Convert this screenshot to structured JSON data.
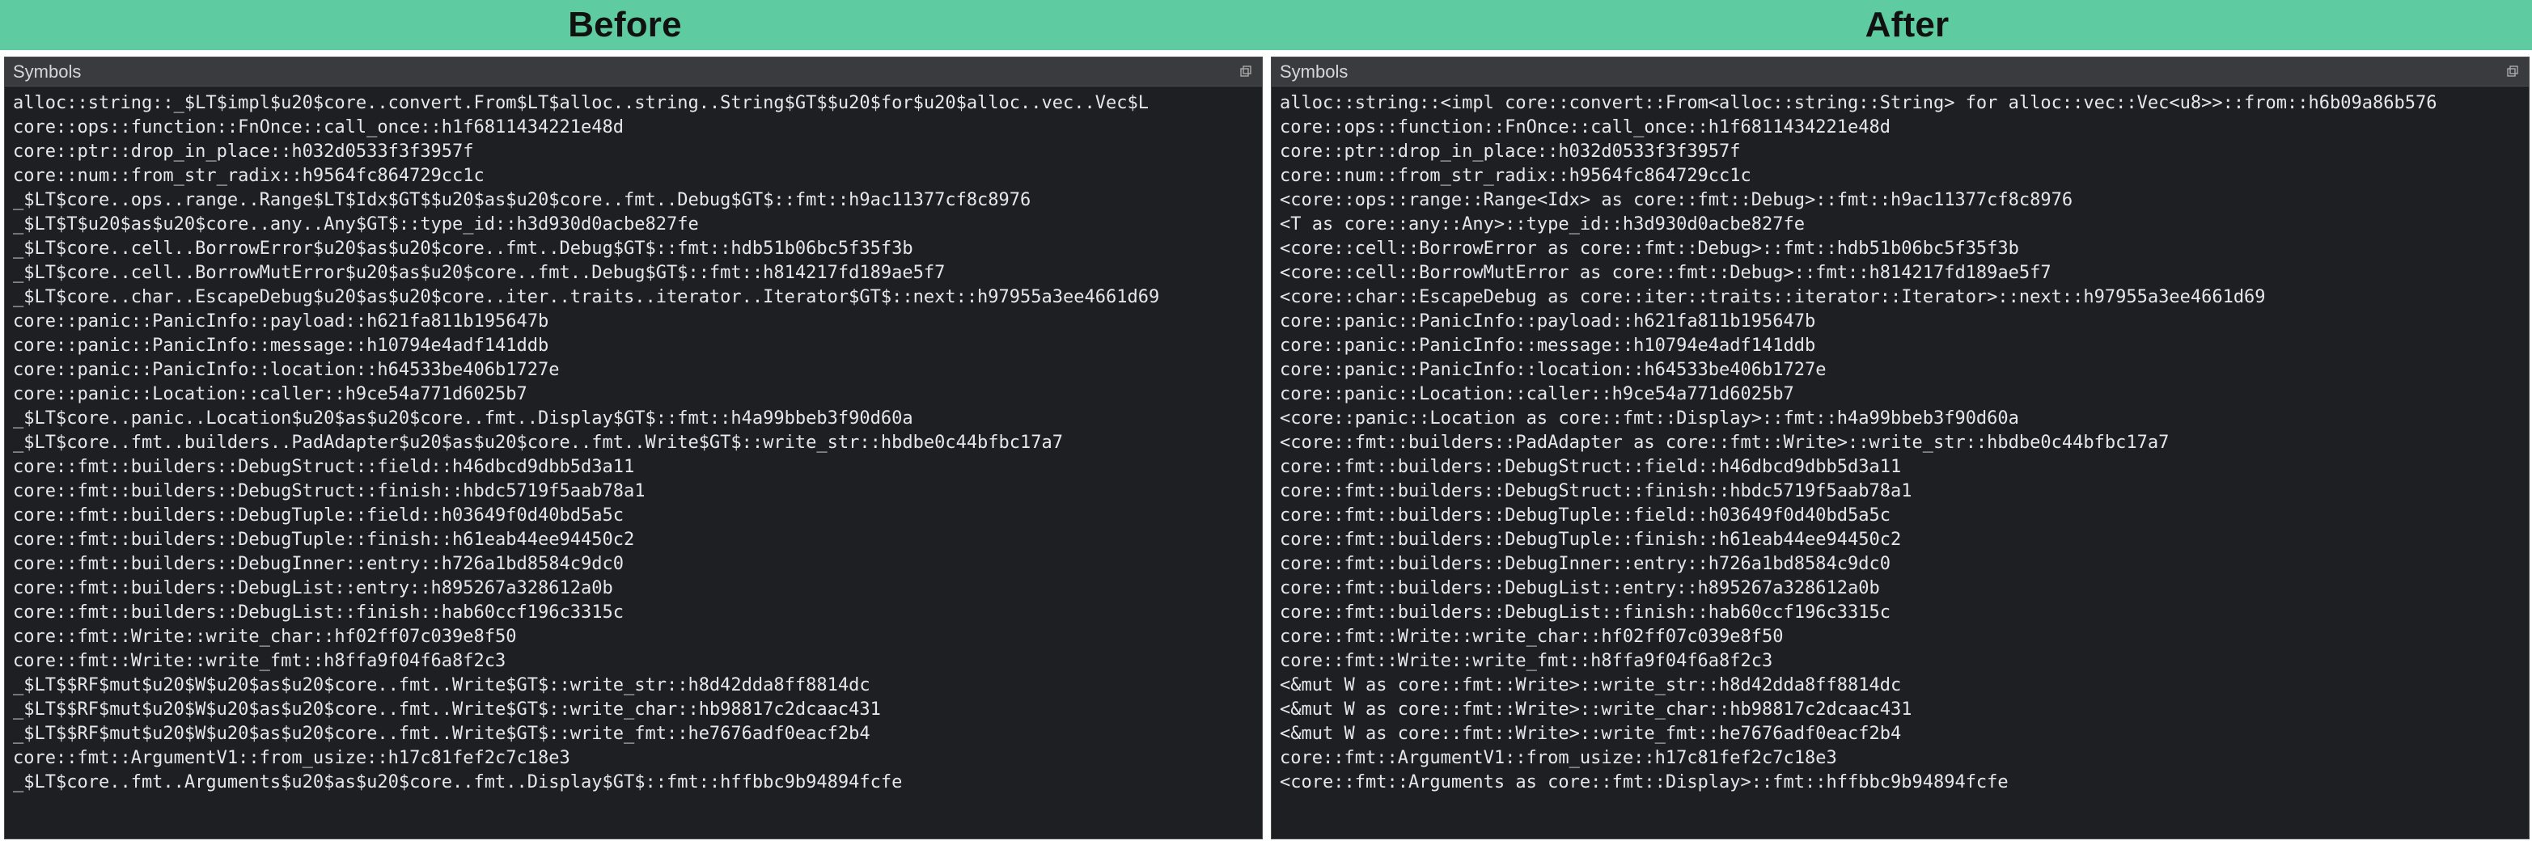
{
  "titles": {
    "before": "Before",
    "after": "After"
  },
  "pane_header": "Symbols",
  "before_lines": [
    "alloc::string::_$LT$impl$u20$core..convert.From$LT$alloc..string..String$GT$$u20$for$u20$alloc..vec..Vec$L",
    "core::ops::function::FnOnce::call_once::h1f6811434221e48d",
    "core::ptr::drop_in_place::h032d0533f3f3957f",
    "core::num::from_str_radix::h9564fc864729cc1c",
    "_$LT$core..ops..range..Range$LT$Idx$GT$$u20$as$u20$core..fmt..Debug$GT$::fmt::h9ac11377cf8c8976",
    "_$LT$T$u20$as$u20$core..any..Any$GT$::type_id::h3d930d0acbe827fe",
    "_$LT$core..cell..BorrowError$u20$as$u20$core..fmt..Debug$GT$::fmt::hdb51b06bc5f35f3b",
    "_$LT$core..cell..BorrowMutError$u20$as$u20$core..fmt..Debug$GT$::fmt::h814217fd189ae5f7",
    "_$LT$core..char..EscapeDebug$u20$as$u20$core..iter..traits..iterator..Iterator$GT$::next::h97955a3ee4661d69",
    "core::panic::PanicInfo::payload::h621fa811b195647b",
    "core::panic::PanicInfo::message::h10794e4adf141ddb",
    "core::panic::PanicInfo::location::h64533be406b1727e",
    "core::panic::Location::caller::h9ce54a771d6025b7",
    "_$LT$core..panic..Location$u20$as$u20$core..fmt..Display$GT$::fmt::h4a99bbeb3f90d60a",
    "_$LT$core..fmt..builders..PadAdapter$u20$as$u20$core..fmt..Write$GT$::write_str::hbdbe0c44bfbc17a7",
    "core::fmt::builders::DebugStruct::field::h46dbcd9dbb5d3a11",
    "core::fmt::builders::DebugStruct::finish::hbdc5719f5aab78a1",
    "core::fmt::builders::DebugTuple::field::h03649f0d40bd5a5c",
    "core::fmt::builders::DebugTuple::finish::h61eab44ee94450c2",
    "core::fmt::builders::DebugInner::entry::h726a1bd8584c9dc0",
    "core::fmt::builders::DebugList::entry::h895267a328612a0b",
    "core::fmt::builders::DebugList::finish::hab60ccf196c3315c",
    "core::fmt::Write::write_char::hf02ff07c039e8f50",
    "core::fmt::Write::write_fmt::h8ffa9f04f6a8f2c3",
    "_$LT$$RF$mut$u20$W$u20$as$u20$core..fmt..Write$GT$::write_str::h8d42dda8ff8814dc",
    "_$LT$$RF$mut$u20$W$u20$as$u20$core..fmt..Write$GT$::write_char::hb98817c2dcaac431",
    "_$LT$$RF$mut$u20$W$u20$as$u20$core..fmt..Write$GT$::write_fmt::he7676adf0eacf2b4",
    "core::fmt::ArgumentV1::from_usize::h17c81fef2c7c18e3",
    "_$LT$core..fmt..Arguments$u20$as$u20$core..fmt..Display$GT$::fmt::hffbbc9b94894fcfe"
  ],
  "after_lines": [
    "alloc::string::<impl core::convert::From<alloc::string::String> for alloc::vec::Vec<u8>>::from::h6b09a86b576",
    "core::ops::function::FnOnce::call_once::h1f6811434221e48d",
    "core::ptr::drop_in_place::h032d0533f3f3957f",
    "core::num::from_str_radix::h9564fc864729cc1c",
    "<core::ops::range::Range<Idx> as core::fmt::Debug>::fmt::h9ac11377cf8c8976",
    "<T as core::any::Any>::type_id::h3d930d0acbe827fe",
    "<core::cell::BorrowError as core::fmt::Debug>::fmt::hdb51b06bc5f35f3b",
    "<core::cell::BorrowMutError as core::fmt::Debug>::fmt::h814217fd189ae5f7",
    "<core::char::EscapeDebug as core::iter::traits::iterator::Iterator>::next::h97955a3ee4661d69",
    "core::panic::PanicInfo::payload::h621fa811b195647b",
    "core::panic::PanicInfo::message::h10794e4adf141ddb",
    "core::panic::PanicInfo::location::h64533be406b1727e",
    "core::panic::Location::caller::h9ce54a771d6025b7",
    "<core::panic::Location as core::fmt::Display>::fmt::h4a99bbeb3f90d60a",
    "<core::fmt::builders::PadAdapter as core::fmt::Write>::write_str::hbdbe0c44bfbc17a7",
    "core::fmt::builders::DebugStruct::field::h46dbcd9dbb5d3a11",
    "core::fmt::builders::DebugStruct::finish::hbdc5719f5aab78a1",
    "core::fmt::builders::DebugTuple::field::h03649f0d40bd5a5c",
    "core::fmt::builders::DebugTuple::finish::h61eab44ee94450c2",
    "core::fmt::builders::DebugInner::entry::h726a1bd8584c9dc0",
    "core::fmt::builders::DebugList::entry::h895267a328612a0b",
    "core::fmt::builders::DebugList::finish::hab60ccf196c3315c",
    "core::fmt::Write::write_char::hf02ff07c039e8f50",
    "core::fmt::Write::write_fmt::h8ffa9f04f6a8f2c3",
    "<&mut W as core::fmt::Write>::write_str::h8d42dda8ff8814dc",
    "<&mut W as core::fmt::Write>::write_char::hb98817c2dcaac431",
    "<&mut W as core::fmt::Write>::write_fmt::he7676adf0eacf2b4",
    "core::fmt::ArgumentV1::from_usize::h17c81fef2c7c18e3",
    "<core::fmt::Arguments as core::fmt::Display>::fmt::hffbbc9b94894fcfe"
  ]
}
